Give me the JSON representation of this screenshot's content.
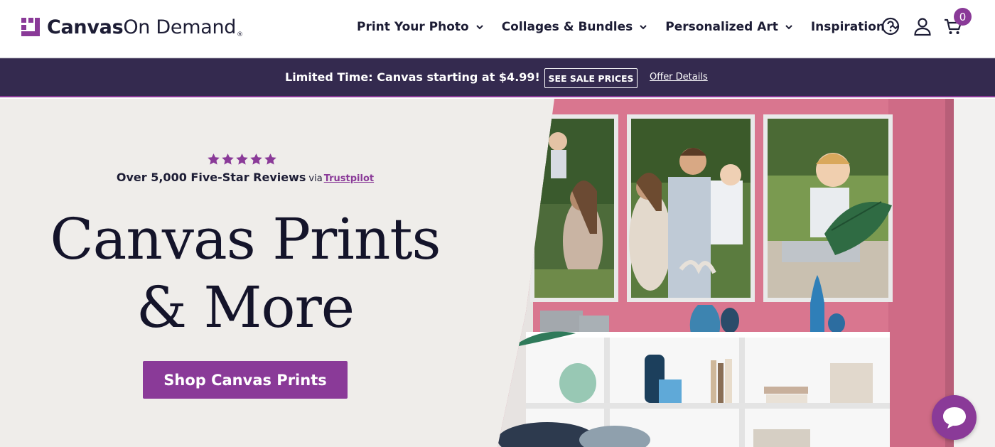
{
  "header": {
    "logo_bold": "Canvas",
    "logo_light": "On Demand",
    "logo_reg": "®",
    "nav": [
      {
        "label": "Print Your Photo"
      },
      {
        "label": "Collages & Bundles"
      },
      {
        "label": "Personalized Art"
      },
      {
        "label": "Inspiration"
      }
    ],
    "cart_count": "0"
  },
  "promo": {
    "text": "Limited Time: Canvas starting at $4.99!",
    "button_label": "SEE SALE PRICES",
    "link_label": "Offer Details"
  },
  "hero": {
    "rating_stars": 5,
    "reviews_text": "Over 5,000 Five-Star Reviews",
    "via_text": "via",
    "trustpilot_label": "Trustpilot",
    "title_line1": "Canvas Prints",
    "title_line2": "& More",
    "cta_label": "Shop Canvas Prints"
  },
  "icons": {
    "help": "help-circle-icon",
    "account": "user-icon",
    "cart": "cart-icon",
    "chat": "chat-bubble-icon"
  },
  "colors": {
    "brand_purple": "#8a3a98",
    "promo_bg": "#342a4f",
    "hero_bg": "#efedea",
    "wall_pink": "#d9738f"
  }
}
